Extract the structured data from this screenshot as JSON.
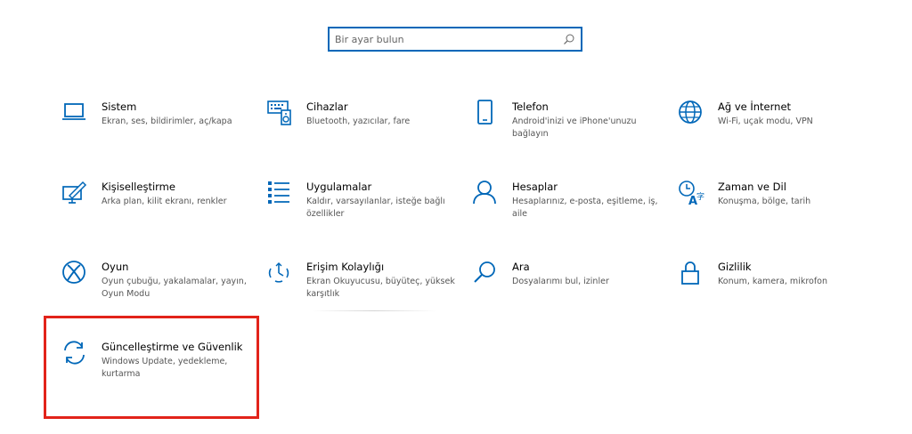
{
  "search": {
    "placeholder": "Bir ayar bulun",
    "icon": "search-icon"
  },
  "tiles": [
    {
      "title": "Sistem",
      "desc": "Ekran, ses, bildirimler, aç/kapa",
      "icon": "laptop-icon"
    },
    {
      "title": "Cihazlar",
      "desc": "Bluetooth, yazıcılar, fare",
      "icon": "devices-icon"
    },
    {
      "title": "Telefon",
      "desc": "Android'inizi ve iPhone'unuzu bağlayın",
      "icon": "phone-icon"
    },
    {
      "title": "Ağ ve İnternet",
      "desc": "Wi-Fi, uçak modu, VPN",
      "icon": "globe-icon"
    },
    {
      "title": "Kişiselleştirme",
      "desc": "Arka plan, kilit ekranı, renkler",
      "icon": "personalization-icon"
    },
    {
      "title": "Uygulamalar",
      "desc": "Kaldır, varsayılanlar, isteğe bağlı özellikler",
      "icon": "apps-list-icon"
    },
    {
      "title": "Hesaplar",
      "desc": "Hesaplarınız, e-posta, eşitleme, iş, aile",
      "icon": "person-icon"
    },
    {
      "title": "Zaman ve Dil",
      "desc": "Konuşma, bölge, tarih",
      "icon": "time-language-icon"
    },
    {
      "title": "Oyun",
      "desc": "Oyun çubuğu, yakalamalar, yayın, Oyun Modu",
      "icon": "xbox-icon"
    },
    {
      "title": "Erişim Kolaylığı",
      "desc": "Ekran Okuyucusu, büyüteç, yüksek karşıtlık",
      "icon": "ease-of-access-icon"
    },
    {
      "title": "Ara",
      "desc": "Dosyalarımı bul, izinler",
      "icon": "search-icon"
    },
    {
      "title": "Gizlilik",
      "desc": "Konum, kamera, mikrofon",
      "icon": "lock-icon"
    },
    {
      "title": "Güncelleştirme ve Güvenlik",
      "desc": "Windows Update, yedekleme, kurtarma",
      "icon": "sync-icon"
    }
  ],
  "colors": {
    "accent": "#0067b8",
    "highlight": "#e2231a"
  }
}
